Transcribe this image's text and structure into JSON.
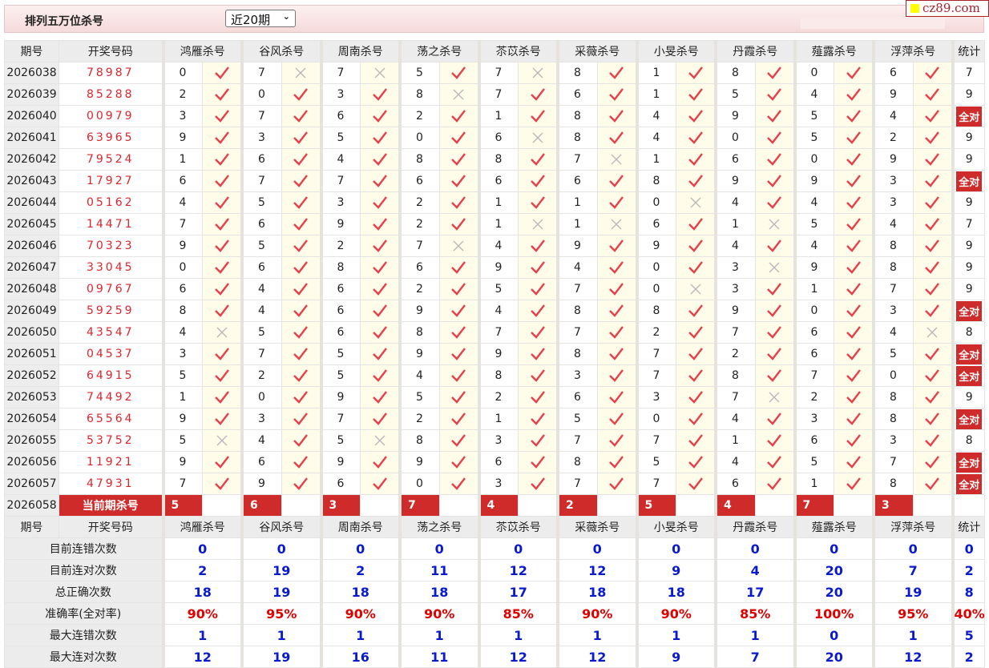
{
  "header": {
    "title": "排列五万位杀号",
    "period_select": "近20期",
    "logo_text": "cz89.com"
  },
  "columns": {
    "period": "期号",
    "draw": "开奖号码",
    "predictors": [
      "鸿雁杀号",
      "谷风杀号",
      "周南杀号",
      "荡之杀号",
      "苶苡杀号",
      "采薇杀号",
      "小旻杀号",
      "丹霞杀号",
      "薤露杀号",
      "浮萍杀号"
    ],
    "stat": "统计"
  },
  "rows": [
    {
      "period": "2026038",
      "draw": "78987",
      "picks": [
        [
          0,
          true
        ],
        [
          7,
          false
        ],
        [
          7,
          false
        ],
        [
          5,
          true
        ],
        [
          7,
          false
        ],
        [
          8,
          true
        ],
        [
          1,
          true
        ],
        [
          8,
          true
        ],
        [
          0,
          true
        ],
        [
          6,
          true
        ]
      ],
      "stat": "7"
    },
    {
      "period": "2026039",
      "draw": "85288",
      "picks": [
        [
          2,
          true
        ],
        [
          0,
          true
        ],
        [
          3,
          true
        ],
        [
          8,
          false
        ],
        [
          7,
          true
        ],
        [
          6,
          true
        ],
        [
          1,
          true
        ],
        [
          5,
          true
        ],
        [
          4,
          true
        ],
        [
          9,
          true
        ]
      ],
      "stat": "9"
    },
    {
      "period": "2026040",
      "draw": "00979",
      "picks": [
        [
          3,
          true
        ],
        [
          7,
          true
        ],
        [
          6,
          true
        ],
        [
          2,
          true
        ],
        [
          1,
          true
        ],
        [
          8,
          true
        ],
        [
          4,
          true
        ],
        [
          9,
          true
        ],
        [
          5,
          true
        ],
        [
          4,
          true
        ]
      ],
      "stat": "全对"
    },
    {
      "period": "2026041",
      "draw": "63965",
      "picks": [
        [
          9,
          true
        ],
        [
          3,
          true
        ],
        [
          5,
          true
        ],
        [
          0,
          true
        ],
        [
          6,
          false
        ],
        [
          8,
          true
        ],
        [
          4,
          true
        ],
        [
          0,
          true
        ],
        [
          5,
          true
        ],
        [
          2,
          true
        ]
      ],
      "stat": "9"
    },
    {
      "period": "2026042",
      "draw": "79524",
      "picks": [
        [
          1,
          true
        ],
        [
          6,
          true
        ],
        [
          4,
          true
        ],
        [
          8,
          true
        ],
        [
          8,
          true
        ],
        [
          7,
          false
        ],
        [
          1,
          true
        ],
        [
          6,
          true
        ],
        [
          0,
          true
        ],
        [
          9,
          true
        ]
      ],
      "stat": "9"
    },
    {
      "period": "2026043",
      "draw": "17927",
      "picks": [
        [
          6,
          true
        ],
        [
          7,
          true
        ],
        [
          7,
          true
        ],
        [
          6,
          true
        ],
        [
          6,
          true
        ],
        [
          6,
          true
        ],
        [
          8,
          true
        ],
        [
          9,
          true
        ],
        [
          9,
          true
        ],
        [
          3,
          true
        ]
      ],
      "stat": "全对"
    },
    {
      "period": "2026044",
      "draw": "05162",
      "picks": [
        [
          4,
          true
        ],
        [
          5,
          true
        ],
        [
          3,
          true
        ],
        [
          2,
          true
        ],
        [
          1,
          true
        ],
        [
          1,
          true
        ],
        [
          0,
          false
        ],
        [
          4,
          true
        ],
        [
          4,
          true
        ],
        [
          3,
          true
        ]
      ],
      "stat": "9"
    },
    {
      "period": "2026045",
      "draw": "14471",
      "picks": [
        [
          7,
          true
        ],
        [
          6,
          true
        ],
        [
          9,
          true
        ],
        [
          2,
          true
        ],
        [
          1,
          false
        ],
        [
          1,
          false
        ],
        [
          6,
          true
        ],
        [
          1,
          false
        ],
        [
          5,
          true
        ],
        [
          4,
          true
        ]
      ],
      "stat": "7"
    },
    {
      "period": "2026046",
      "draw": "70323",
      "picks": [
        [
          9,
          true
        ],
        [
          5,
          true
        ],
        [
          2,
          true
        ],
        [
          7,
          false
        ],
        [
          4,
          true
        ],
        [
          9,
          true
        ],
        [
          9,
          true
        ],
        [
          4,
          true
        ],
        [
          4,
          true
        ],
        [
          8,
          true
        ]
      ],
      "stat": "9"
    },
    {
      "period": "2026047",
      "draw": "33045",
      "picks": [
        [
          0,
          true
        ],
        [
          6,
          true
        ],
        [
          8,
          true
        ],
        [
          6,
          true
        ],
        [
          9,
          true
        ],
        [
          4,
          true
        ],
        [
          0,
          true
        ],
        [
          3,
          false
        ],
        [
          9,
          true
        ],
        [
          8,
          true
        ]
      ],
      "stat": "9"
    },
    {
      "period": "2026048",
      "draw": "09767",
      "picks": [
        [
          6,
          true
        ],
        [
          4,
          true
        ],
        [
          6,
          true
        ],
        [
          2,
          true
        ],
        [
          5,
          true
        ],
        [
          7,
          true
        ],
        [
          0,
          false
        ],
        [
          3,
          true
        ],
        [
          1,
          true
        ],
        [
          7,
          true
        ]
      ],
      "stat": "9"
    },
    {
      "period": "2026049",
      "draw": "59259",
      "picks": [
        [
          8,
          true
        ],
        [
          4,
          true
        ],
        [
          6,
          true
        ],
        [
          9,
          true
        ],
        [
          4,
          true
        ],
        [
          8,
          true
        ],
        [
          8,
          true
        ],
        [
          9,
          true
        ],
        [
          0,
          true
        ],
        [
          3,
          true
        ]
      ],
      "stat": "全对"
    },
    {
      "period": "2026050",
      "draw": "43547",
      "picks": [
        [
          4,
          false
        ],
        [
          5,
          true
        ],
        [
          6,
          true
        ],
        [
          8,
          true
        ],
        [
          7,
          true
        ],
        [
          7,
          true
        ],
        [
          2,
          true
        ],
        [
          7,
          true
        ],
        [
          6,
          true
        ],
        [
          4,
          false
        ]
      ],
      "stat": "8"
    },
    {
      "period": "2026051",
      "draw": "04537",
      "picks": [
        [
          3,
          true
        ],
        [
          7,
          true
        ],
        [
          5,
          true
        ],
        [
          9,
          true
        ],
        [
          9,
          true
        ],
        [
          8,
          true
        ],
        [
          7,
          true
        ],
        [
          2,
          true
        ],
        [
          6,
          true
        ],
        [
          5,
          true
        ]
      ],
      "stat": "全对"
    },
    {
      "period": "2026052",
      "draw": "64915",
      "picks": [
        [
          5,
          true
        ],
        [
          2,
          true
        ],
        [
          5,
          true
        ],
        [
          4,
          true
        ],
        [
          8,
          true
        ],
        [
          3,
          true
        ],
        [
          7,
          true
        ],
        [
          8,
          true
        ],
        [
          7,
          true
        ],
        [
          0,
          true
        ]
      ],
      "stat": "全对"
    },
    {
      "period": "2026053",
      "draw": "74492",
      "picks": [
        [
          1,
          true
        ],
        [
          0,
          true
        ],
        [
          9,
          true
        ],
        [
          5,
          true
        ],
        [
          2,
          true
        ],
        [
          6,
          true
        ],
        [
          3,
          true
        ],
        [
          7,
          false
        ],
        [
          2,
          true
        ],
        [
          8,
          true
        ]
      ],
      "stat": "9"
    },
    {
      "period": "2026054",
      "draw": "65564",
      "picks": [
        [
          9,
          true
        ],
        [
          3,
          true
        ],
        [
          7,
          true
        ],
        [
          2,
          true
        ],
        [
          1,
          true
        ],
        [
          5,
          true
        ],
        [
          0,
          true
        ],
        [
          4,
          true
        ],
        [
          3,
          true
        ],
        [
          8,
          true
        ]
      ],
      "stat": "全对"
    },
    {
      "period": "2026055",
      "draw": "53752",
      "picks": [
        [
          5,
          false
        ],
        [
          4,
          true
        ],
        [
          5,
          false
        ],
        [
          8,
          true
        ],
        [
          3,
          true
        ],
        [
          7,
          true
        ],
        [
          7,
          true
        ],
        [
          1,
          true
        ],
        [
          6,
          true
        ],
        [
          3,
          true
        ]
      ],
      "stat": "8"
    },
    {
      "period": "2026056",
      "draw": "11921",
      "picks": [
        [
          9,
          true
        ],
        [
          6,
          true
        ],
        [
          9,
          true
        ],
        [
          9,
          true
        ],
        [
          6,
          true
        ],
        [
          8,
          true
        ],
        [
          5,
          true
        ],
        [
          4,
          true
        ],
        [
          5,
          true
        ],
        [
          7,
          true
        ]
      ],
      "stat": "全对"
    },
    {
      "period": "2026057",
      "draw": "47931",
      "picks": [
        [
          7,
          true
        ],
        [
          9,
          true
        ],
        [
          6,
          true
        ],
        [
          0,
          true
        ],
        [
          3,
          true
        ],
        [
          7,
          true
        ],
        [
          7,
          true
        ],
        [
          6,
          true
        ],
        [
          1,
          true
        ],
        [
          8,
          true
        ]
      ],
      "stat": "全对"
    }
  ],
  "current": {
    "period": "2026058",
    "label": "当前期杀号",
    "picks": [
      "5",
      "6",
      "3",
      "7",
      "4",
      "2",
      "5",
      "4",
      "7",
      "3"
    ]
  },
  "summary": [
    {
      "label": "目前连错次数",
      "values": [
        "0",
        "0",
        "0",
        "0",
        "0",
        "0",
        "0",
        "0",
        "0",
        "0"
      ],
      "stat": "0",
      "red": false
    },
    {
      "label": "目前连对次数",
      "values": [
        "2",
        "19",
        "2",
        "11",
        "12",
        "12",
        "9",
        "4",
        "20",
        "7"
      ],
      "stat": "2",
      "red": false
    },
    {
      "label": "总正确次数",
      "values": [
        "18",
        "19",
        "18",
        "18",
        "17",
        "18",
        "18",
        "17",
        "20",
        "19"
      ],
      "stat": "8",
      "red": false
    },
    {
      "label": "准确率(全对率)",
      "values": [
        "90%",
        "95%",
        "90%",
        "90%",
        "85%",
        "90%",
        "90%",
        "85%",
        "100%",
        "95%"
      ],
      "stat": "40%",
      "red": true
    },
    {
      "label": "最大连错次数",
      "values": [
        "1",
        "1",
        "1",
        "1",
        "1",
        "1",
        "1",
        "1",
        "0",
        "1"
      ],
      "stat": "5",
      "red": false
    },
    {
      "label": "最大连对次数",
      "values": [
        "12",
        "19",
        "16",
        "11",
        "12",
        "12",
        "9",
        "7",
        "20",
        "12"
      ],
      "stat": "2",
      "red": false
    }
  ],
  "colors": {
    "check": "#e8404a",
    "cross": "#b8b8b8",
    "badge": "#cf2b2b",
    "blue": "#0a1ad0",
    "red": "#e00000"
  }
}
